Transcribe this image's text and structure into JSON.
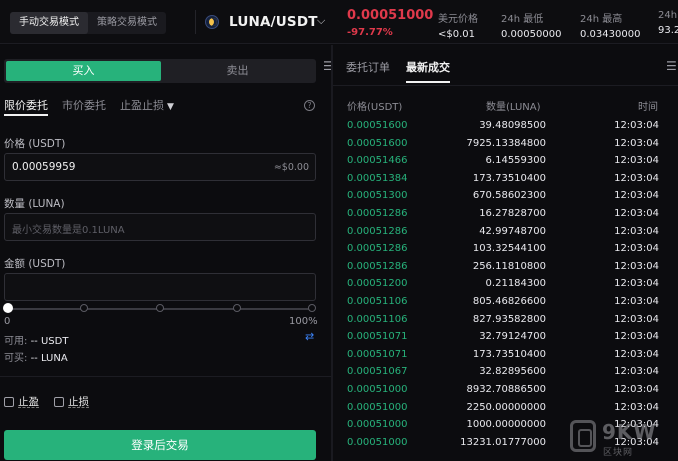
{
  "header": {
    "modes": [
      "手动交易模式",
      "策略交易模式"
    ],
    "pair": "LUNA/USDT",
    "last_price": "0.00051000",
    "change": "-97.77%",
    "stats": [
      {
        "label": "美元价格",
        "value": "<$0.01"
      },
      {
        "label": "24h 最低",
        "value": "0.00050000"
      },
      {
        "label": "24h 最高",
        "value": "0.03430000"
      },
      {
        "label": "24h",
        "value": "93.2"
      }
    ]
  },
  "order_form": {
    "buy_label": "买入",
    "sell_label": "卖出",
    "order_types": [
      "限价委托",
      "市价委托",
      "止盈止损"
    ],
    "price_label": "价格 (USDT)",
    "price_value": "0.00059959",
    "price_usd": "≈$0.00",
    "amount_label": "数量 (LUNA)",
    "amount_placeholder": "最小交易数量是0.1LUNA",
    "total_label": "金额 (USDT)",
    "slider_min": "0",
    "slider_max": "100%",
    "slider_value": 0,
    "available_label": "可用:",
    "available_value": "-- USDT",
    "can_buy_label": "可买:",
    "can_buy_value": "-- LUNA",
    "take_profit_label": "止盈",
    "stop_loss_label": "止损",
    "submit_label": "登录后交易"
  },
  "trades": {
    "tabs": [
      "委托订单",
      "最新成交"
    ],
    "columns": [
      "价格(USDT)",
      "数量(LUNA)",
      "时间"
    ],
    "rows": [
      [
        "0.00051600",
        "39.48098500",
        "12:03:04"
      ],
      [
        "0.00051600",
        "7925.13384800",
        "12:03:04"
      ],
      [
        "0.00051466",
        "6.14559300",
        "12:03:04"
      ],
      [
        "0.00051384",
        "173.73510400",
        "12:03:04"
      ],
      [
        "0.00051300",
        "670.58602300",
        "12:03:04"
      ],
      [
        "0.00051286",
        "16.27828700",
        "12:03:04"
      ],
      [
        "0.00051286",
        "42.99748700",
        "12:03:04"
      ],
      [
        "0.00051286",
        "103.32544100",
        "12:03:04"
      ],
      [
        "0.00051286",
        "256.11810800",
        "12:03:04"
      ],
      [
        "0.00051200",
        "0.21184300",
        "12:03:04"
      ],
      [
        "0.00051106",
        "805.46826600",
        "12:03:04"
      ],
      [
        "0.00051106",
        "827.93582800",
        "12:03:04"
      ],
      [
        "0.00051071",
        "32.79124700",
        "12:03:04"
      ],
      [
        "0.00051071",
        "173.73510400",
        "12:03:04"
      ],
      [
        "0.00051067",
        "32.82895600",
        "12:03:04"
      ],
      [
        "0.00051000",
        "8932.70886500",
        "12:03:04"
      ],
      [
        "0.00051000",
        "2250.00000000",
        "12:03:04"
      ],
      [
        "0.00051000",
        "1000.00000000",
        "12:03:04"
      ],
      [
        "0.00051000",
        "13231.01777000",
        "12:03:04"
      ]
    ]
  },
  "watermark": {
    "text": "9KW",
    "sub": "区块网"
  },
  "colors": {
    "buy": "#27b27b",
    "sell": "#e0394b",
    "background": "#0c0c0f"
  },
  "icons": [
    "luna-logo-icon",
    "chevron-down-icon",
    "menu-icon",
    "help-icon",
    "swap-icon"
  ]
}
